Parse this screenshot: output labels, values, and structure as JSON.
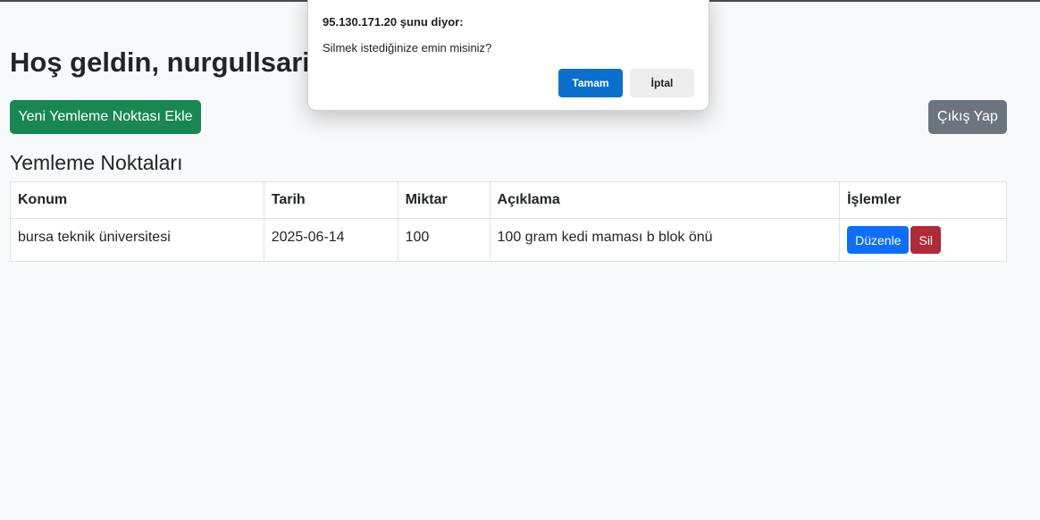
{
  "header": {
    "welcome": "Hoş geldin, nurgullsarit"
  },
  "toolbar": {
    "add_label": "Yeni Yemleme Noktası Ekle",
    "logout_label": "Çıkış Yap"
  },
  "section": {
    "title": "Yemleme Noktaları"
  },
  "table": {
    "columns": [
      "Konum",
      "Tarih",
      "Miktar",
      "Açıklama",
      "İşlemler"
    ],
    "rows": [
      {
        "konum": "bursa teknik üniversitesi",
        "tarih": "2025-06-14",
        "miktar": "100",
        "aciklama": "100 gram kedi maması b blok önü",
        "edit_label": "Düzenle",
        "delete_label": "Sil"
      }
    ]
  },
  "dialog": {
    "title": "95.130.171.20 şunu diyor:",
    "message": "Silmek istediğinize emin misiniz?",
    "ok_label": "Tamam",
    "cancel_label": "İptal"
  },
  "colors": {
    "success": "#198754",
    "secondary": "#6c757d",
    "primary": "#0d6efd",
    "danger": "#b02a37",
    "dialog_ok": "#0b6fce"
  }
}
